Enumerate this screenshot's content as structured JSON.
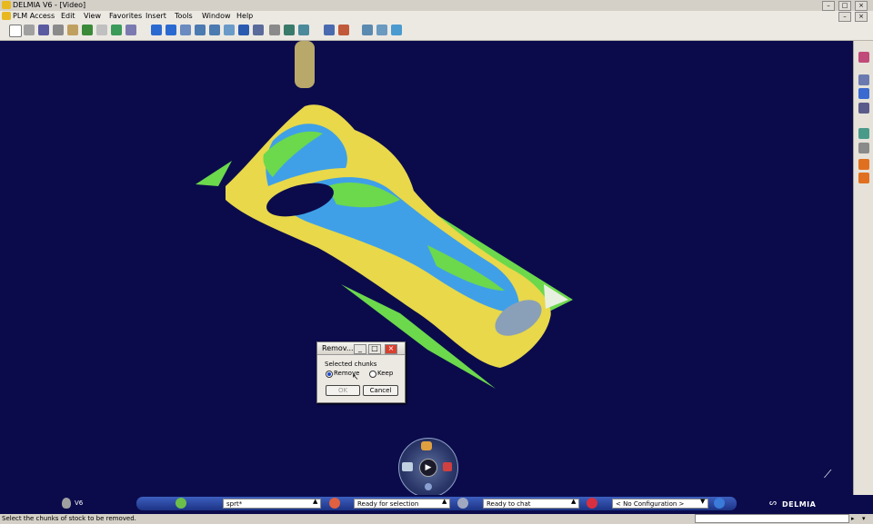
{
  "window": {
    "title": "DELMIA V6 - [Video]"
  },
  "menu": [
    {
      "label": "PLM Access",
      "key": "plm"
    },
    {
      "label": "Edit",
      "key": "edit"
    },
    {
      "label": "View",
      "key": "view"
    },
    {
      "label": "Favorites",
      "key": "favorites"
    },
    {
      "label": "Insert",
      "key": "insert"
    },
    {
      "label": "Tools",
      "key": "tools"
    },
    {
      "label": "Window",
      "key": "window"
    },
    {
      "label": "Help",
      "key": "help"
    }
  ],
  "dialog": {
    "title": "Remov...",
    "group_label": "Selected chunks",
    "option_remove": "Remove",
    "option_keep": "Keep",
    "selected": "Remove",
    "ok_label": "OK",
    "cancel_label": "Cancel"
  },
  "statusbar": {
    "logo": "V6",
    "search_value": "sprt*",
    "status_selection": "Ready for selection",
    "status_chat": "Ready to chat",
    "config_value": "< No Configuration >",
    "brand": "DELMIA",
    "prompt": "Select the chunks of stock to be removed."
  },
  "colors": {
    "viewport_bg": "#0b0b4c",
    "part_yellow": "#e8d84a",
    "part_blue": "#3fa0e8",
    "part_green": "#6cd84c"
  }
}
